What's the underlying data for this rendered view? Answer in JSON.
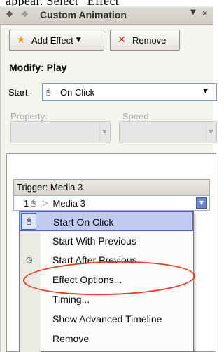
{
  "caption": "appear. Select \"Effect",
  "title_bar": {
    "back_icon": "back-arrow-icon",
    "forward_icon": "forward-arrow-icon",
    "title": "Custom Animation",
    "menu_glyph": "▼",
    "close_glyph": "×"
  },
  "toolbar": {
    "add_effect_label": "Add Effect",
    "add_effect_caret": "▼",
    "remove_label": "Remove"
  },
  "modify": {
    "heading": "Modify: Play",
    "start_label": "Start:",
    "start_value": "On Click",
    "property_label": "Property:",
    "speed_label": "Speed:"
  },
  "animation_list": {
    "trigger_label": "Trigger: Media 3",
    "item_number": "1",
    "item_name": "Media 3"
  },
  "context_menu": {
    "items": [
      {
        "label": "Start On Click",
        "icon": "mouse-icon",
        "selected": true
      },
      {
        "label": "Start With Previous",
        "icon": "",
        "selected": false
      },
      {
        "label": "Start After Previous",
        "icon": "clock-icon",
        "selected": false
      },
      {
        "label": "Effect Options...",
        "icon": "",
        "selected": false
      },
      {
        "label": "Timing...",
        "icon": "",
        "selected": false
      },
      {
        "label": "Show Advanced Timeline",
        "icon": "",
        "selected": false
      },
      {
        "label": "Remove",
        "icon": "",
        "selected": false
      }
    ]
  },
  "colors": {
    "selection": "#c1cbf0",
    "selection_border": "#4b63c8",
    "annotation": "#e83a25"
  }
}
